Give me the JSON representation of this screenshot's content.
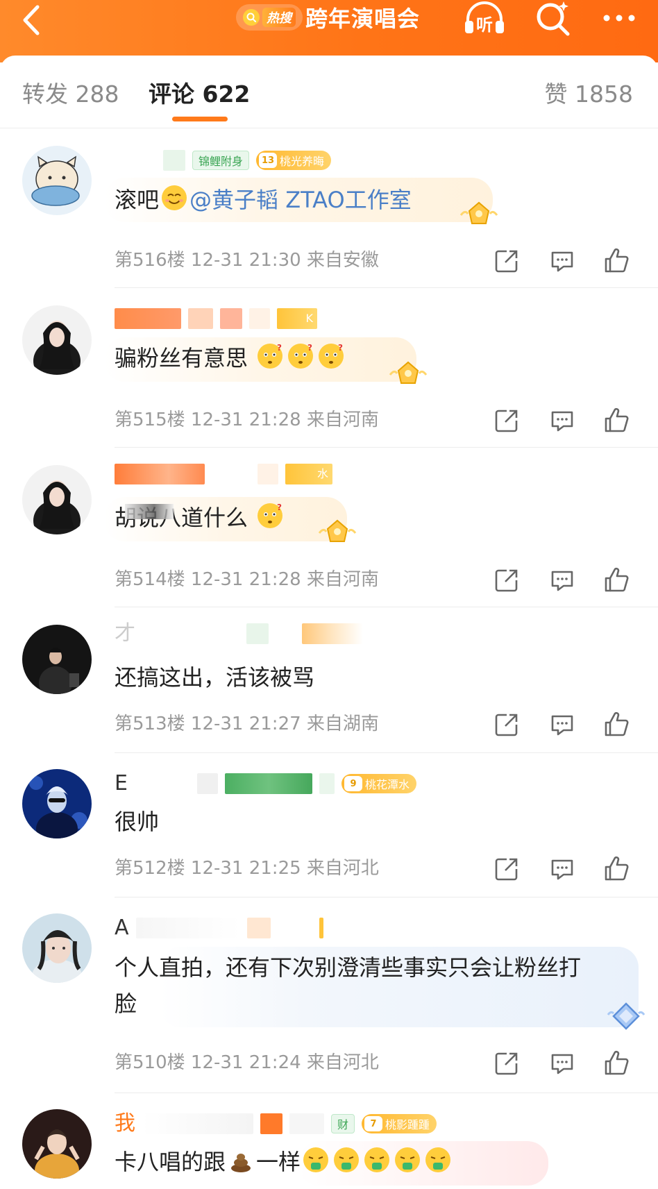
{
  "header": {
    "hot_label": "热搜",
    "title": "跨年演唱会"
  },
  "tabs": {
    "repost_label": "转发",
    "repost_count": "288",
    "comment_label": "评论",
    "comment_count": "622",
    "likes_label": "赞",
    "likes_count": "1858"
  },
  "comments": [
    {
      "badge_text": "锦鲤附身",
      "fan_level": "13",
      "fan_badge": "桃光养晦",
      "text_prefix": "滚吧",
      "mention": "@黄子韬 ZTAO工作室",
      "floor": "第516楼",
      "time": "12-31 21:30",
      "location": "来自安徽"
    },
    {
      "name_suffix": "K",
      "text": "骗粉丝有意思",
      "floor": "第515楼",
      "time": "12-31 21:28",
      "location": "来自河南"
    },
    {
      "name_suffix": "水",
      "text": "胡说八道什么",
      "floor": "第514楼",
      "time": "12-31 21:28",
      "location": "来自河南"
    },
    {
      "name_initial": "才",
      "text": "还搞这出，活该被骂",
      "floor": "第513楼",
      "time": "12-31 21:27",
      "location": "来自湖南"
    },
    {
      "name_initial": "E",
      "fan_level": "9",
      "fan_badge": "桃花潭水",
      "text": "很帅",
      "floor": "第512楼",
      "time": "12-31 21:25",
      "location": "来自河北"
    },
    {
      "name_initial": "A",
      "text_line1": "个人直拍，还有下次别澄清些事实只会让粉丝打",
      "text_line2": "脸",
      "floor": "第510楼",
      "time": "12-31 21:24",
      "location": "来自河北"
    },
    {
      "name_initial": "我",
      "badge_text": "财",
      "fan_level": "7",
      "fan_badge": "桃影踵踵",
      "text_prefix": "卡八唱的跟",
      "text_mid": "一样"
    }
  ],
  "colors": {
    "brand_orange": "#ff7417",
    "mention_blue": "#4a7fc7",
    "meta_gray": "#9a9a9a"
  },
  "icons": [
    "back-icon",
    "search-icon",
    "listen-icon",
    "more-icon",
    "share-icon",
    "reply-icon",
    "like-icon",
    "crown-icon"
  ]
}
